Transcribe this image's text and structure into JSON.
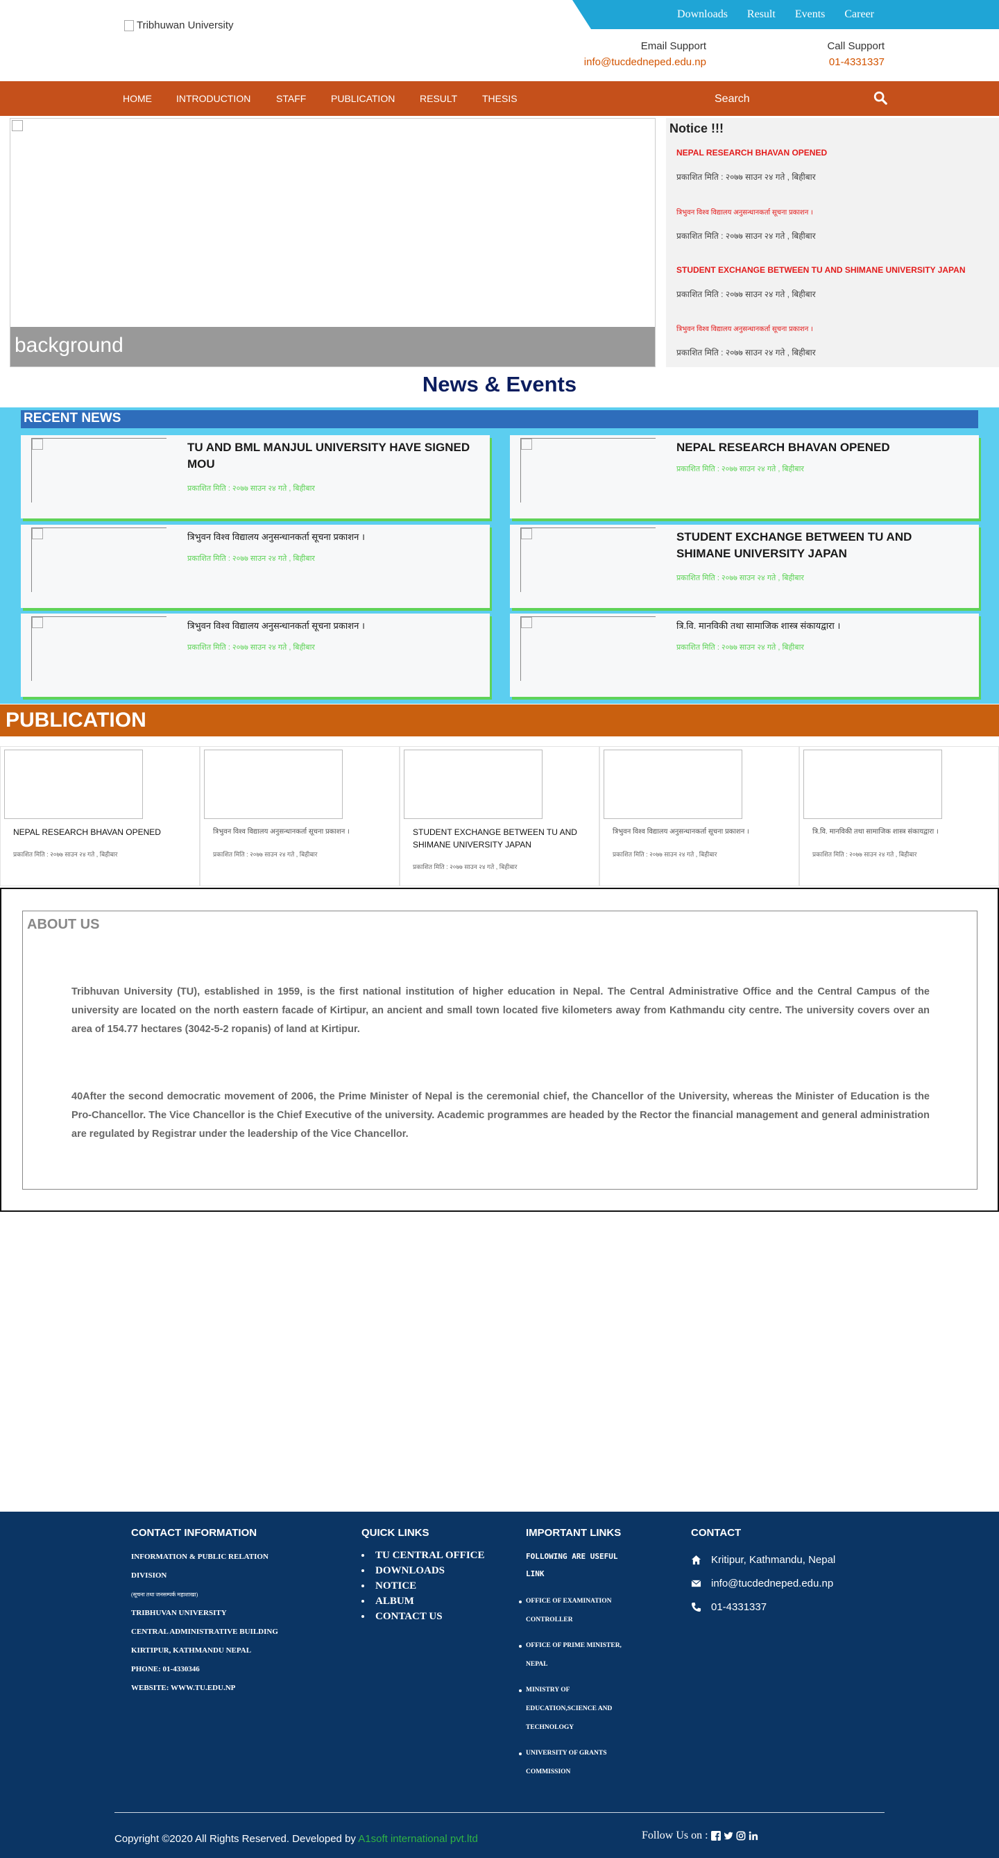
{
  "header": {
    "logo_alt": "Tribhuwan University",
    "toplinks": [
      "Downloads",
      "Result",
      "Events",
      "Career"
    ],
    "email_label": "Email Support",
    "email_value": "info@tucdedneped.edu.np",
    "call_label": "Call Support",
    "call_value": "01-4331337"
  },
  "nav": {
    "items": [
      "HOME",
      "INTRODUCTION",
      "STAFF",
      "PUBLICATION",
      "RESULT",
      "THESIS"
    ],
    "search_placeholder": "Search"
  },
  "hero": {
    "caption": "background"
  },
  "notice": {
    "title": "Notice !!!",
    "items": [
      {
        "title": "NEPAL RESEARCH BHAVAN OPENED",
        "date": "प्रकाशित मिति : २०७७ साउन २४ गते , बिहीबार"
      },
      {
        "title": "त्रिभुवन विश्व विद्यालय अनुसन्धानकर्ता सूचना प्रकाशन ।",
        "date": "प्रकाशित मिति : २०७७ साउन २४ गते , बिहीबार"
      },
      {
        "title": "STUDENT EXCHANGE BETWEEN TU AND SHIMANE UNIVERSITY JAPAN",
        "date": "प्रकाशित मिति : २०७७ साउन २४ गते , बिहीबार"
      },
      {
        "title": "त्रिभुवन विश्व विद्यालय अनुसन्धानकर्ता सूचना प्रकाशन ।",
        "date": "प्रकाशित मिति : २०७७ साउन २४ गते , बिहीबार"
      }
    ]
  },
  "news": {
    "section_title": "News & Events",
    "bar_title": "RECENT NEWS",
    "cards": [
      {
        "title": "TU AND BML MANJUL UNIVERSITY HAVE SIGNED MOU",
        "date": "प्रकाशित मिति : २०७७ साउन २४ गते , बिहीबार"
      },
      {
        "title": "NEPAL RESEARCH BHAVAN OPENED",
        "date": "प्रकाशित मिति : २०७७ साउन २४ गते , बिहीबार"
      },
      {
        "title": "त्रिभुवन विश्व विद्यालय अनुसन्धानकर्ता सूचना प्रकाशन ।",
        "date": "प्रकाशित मिति : २०७७ साउन २४ गते , बिहीबार"
      },
      {
        "title": "STUDENT EXCHANGE BETWEEN TU AND SHIMANE UNIVERSITY JAPAN",
        "date": "प्रकाशित मिति : २०७७ साउन २४ गते , बिहीबार"
      },
      {
        "title": "त्रिभुवन विश्व विद्यालय अनुसन्धानकर्ता सूचना प्रकाशन ।",
        "date": "प्रकाशित मिति : २०७७ साउन २४ गते , बिहीबार"
      },
      {
        "title": "त्रि.वि. मानविकी तथा सामाजिक शास्त्र संकायद्वारा ।",
        "date": "प्रकाशित मिति : २०७७ साउन २४ गते , बिहीबार"
      }
    ]
  },
  "publication": {
    "bar_title": "PUBLICATION",
    "items": [
      {
        "title": "NEPAL RESEARCH BHAVAN OPENED",
        "date": "प्रकाशित मिति : २०७७ साउन २४ गते , बिहीबार"
      },
      {
        "title": "त्रिभुवन विश्व विद्यालय अनुसन्धानकर्ता सूचना प्रकाशन ।",
        "date": "प्रकाशित मिति : २०७७ साउन २४ गते , बिहीबार"
      },
      {
        "title": "STUDENT EXCHANGE BETWEEN TU AND SHIMANE UNIVERSITY JAPAN",
        "date": "प्रकाशित मिति : २०७७ साउन २४ गते , बिहीबार"
      },
      {
        "title": "त्रिभुवन विश्व विद्यालय अनुसन्धानकर्ता सूचना प्रकाशन ।",
        "date": "प्रकाशित मिति : २०७७ साउन २४ गते , बिहीबार"
      },
      {
        "title": "त्रि.वि. मानविकी तथा सामाजिक शास्त्र संकायद्वारा ।",
        "date": "प्रकाशित मिति : २०७७ साउन २४ गते , बिहीबार"
      }
    ]
  },
  "about": {
    "title": "ABOUT US",
    "p1": "Tribhuvan University (TU),  established in 1959, is the first national institution of higher education in Nepal. The Central Administrative Office and the Central Campus of the university are located on the north eastern facade of Kirtipur, an ancient and small town located five kilometers away from Kathmandu city centre. The university covers over an area of 154.77 hectares (3042-5-2 ropanis) of land at Kirtipur.",
    "p2": " 40After the second democratic movement of 2006, the Prime Minister of Nepal is the ceremonial chief, the Chancellor of the University, whereas the Minister of Education is the Pro-Chancellor. The Vice Chancellor is the Chief Executive of the university. Academic programmes are headed by the Rector the financial management and general administration are regulated by Registrar under the leadership of the Vice Chancellor."
  },
  "footer": {
    "contact_info": {
      "title": "CONTACT INFORMATION",
      "lines": [
        "INFORMATION & PUBLIC RELATION",
        "DIVISION",
        "(सूचना तथा जनसम्पर्क महाशाखा)",
        "TRIBHUVAN UNIVERSITY",
        "CENTRAL ADMINISTRATIVE BUILDING",
        "KIRTIPUR, KATHMANDU NEPAL",
        "PHONE: 01-4330346",
        "WEBSITE: WWW.TU.EDU.NP"
      ]
    },
    "quick_links": {
      "title": "QUICK LINKS",
      "items": [
        "TU CENTRAL OFFICE",
        "DOWNLOADS",
        "NOTICE",
        "ALBUM",
        "CONTACT US"
      ]
    },
    "important_links": {
      "title": "IMPORTANT LINKS",
      "intro": "FOLLOWING ARE USEFUL LINK",
      "items": [
        "OFFICE OF EXAMINATION CONTROLLER",
        "OFFICE OF PRIME MINISTER, NEPAL",
        "MINISTRY OF EDUCATION,SCIENCE AND TECHNOLOGY",
        "UNIVERSITY OF GRANTS COMMISSION"
      ]
    },
    "contact": {
      "title": "CONTACT",
      "address": "Kritipur, Kathmandu, Nepal",
      "email": "info@tucdedneped.edu.np",
      "phone": "01-4331337"
    },
    "copyright": "Copyright ©2020 All Rights Reserved. Developed by ",
    "developer": "A1soft international pvt.ltd",
    "follow": "Follow Us on : "
  }
}
